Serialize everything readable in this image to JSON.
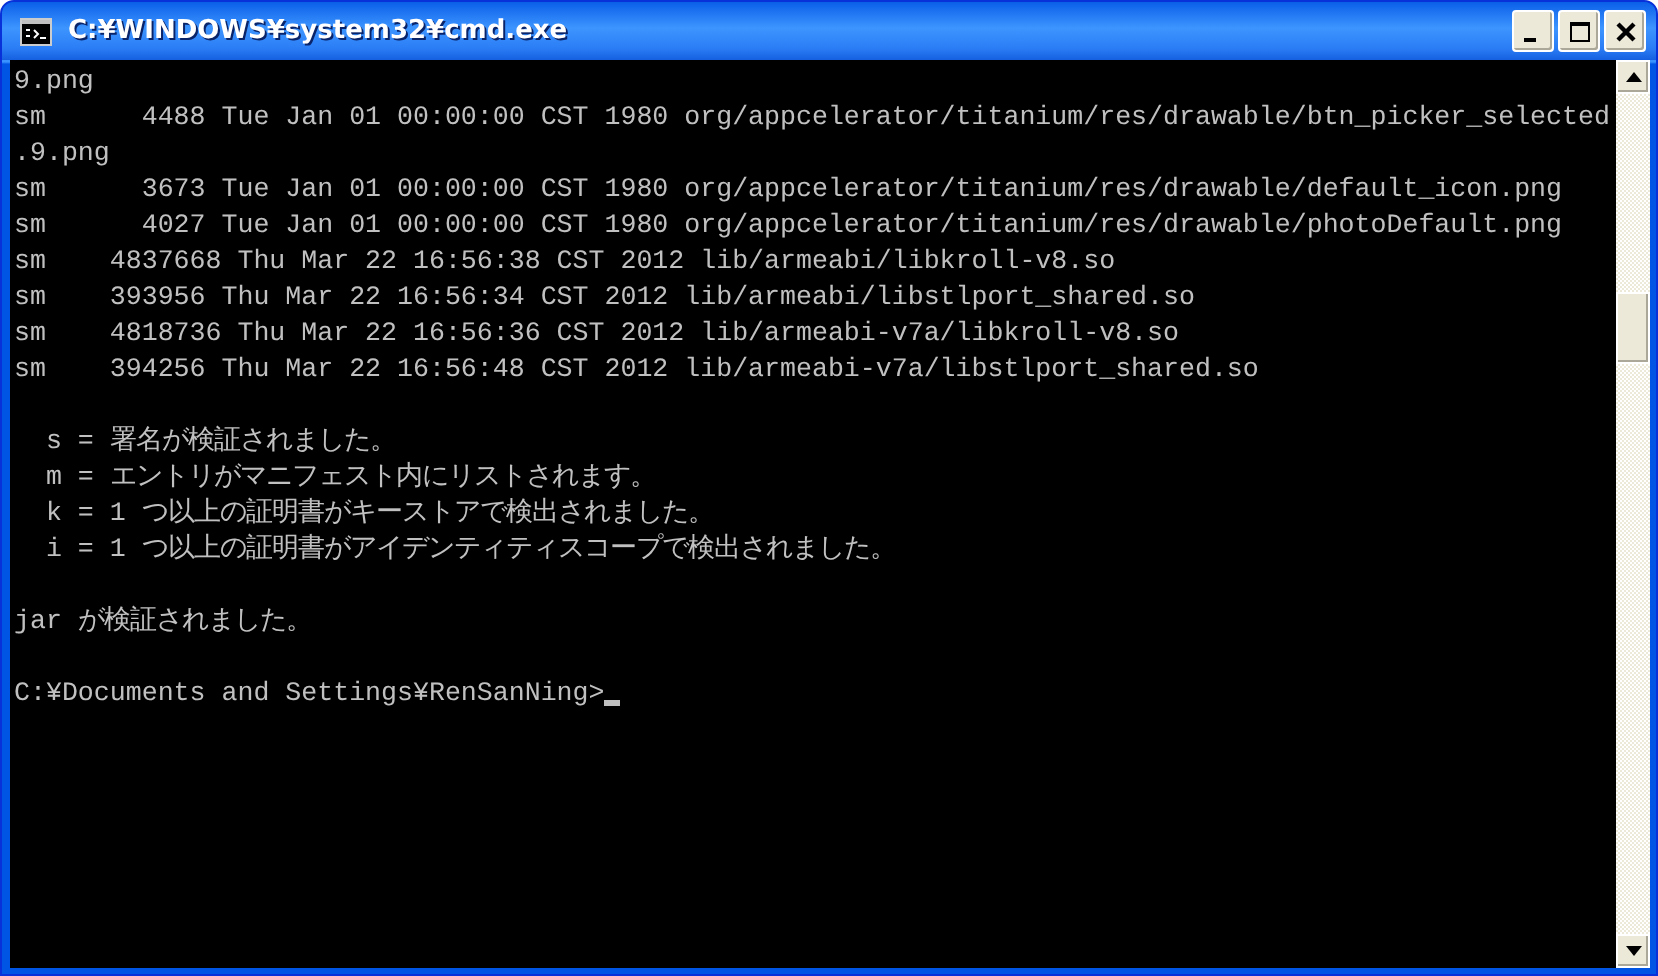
{
  "window": {
    "title": "C:¥WINDOWS¥system32¥cmd.exe"
  },
  "blocks": [
    {
      "lines": [
        "9.png",
        "sm      4488 Tue Jan 01 00:00:00 CST 1980 org/appcelerator/titanium/res/drawable/btn_picker_selected",
        ".9.png",
        "sm      3673 Tue Jan 01 00:00:00 CST 1980 org/appcelerator/titanium/res/drawable/default_icon.png",
        "sm      4027 Tue Jan 01 00:00:00 CST 1980 org/appcelerator/titanium/res/drawable/photoDefault.png",
        "sm    4837668 Thu Mar 22 16:56:38 CST 2012 lib/armeabi/libkroll-v8.so",
        "sm    393956 Thu Mar 22 16:56:34 CST 2012 lib/armeabi/libstlport_shared.so",
        "sm    4818736 Thu Mar 22 16:56:36 CST 2012 lib/armeabi-v7a/libkroll-v8.so",
        "sm    394256 Thu Mar 22 16:56:48 CST 2012 lib/armeabi-v7a/libstlport_shared.so"
      ]
    },
    {
      "lines": [
        "  s = 署名が検証されました。",
        "  m = エントリがマニフェスト内にリストされます。",
        "  k = 1 つ以上の証明書がキーストアで検出されました。",
        "  i = 1 つ以上の証明書がアイデンティティスコープで検出されました。"
      ]
    },
    {
      "lines": [
        "jar が検証されました。"
      ]
    }
  ],
  "prompt": {
    "text": "C:¥Documents and Settings¥RenSanNing>",
    "cursor": true
  }
}
